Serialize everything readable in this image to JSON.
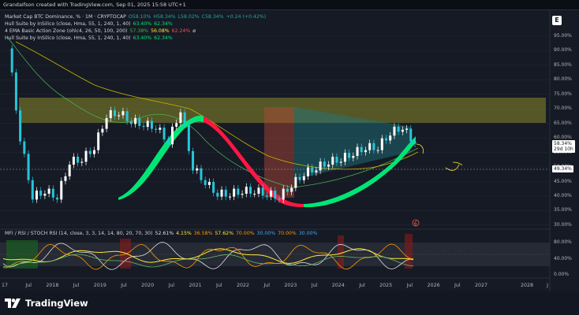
{
  "header": {
    "attribution": "GrandaIfson created with TradingView.com, Sep 01, 2025 15:58 UTC+1"
  },
  "legend": {
    "main": {
      "symbol": "Market Cap BTC Dominance, % · 1M · CRYPTOCAP",
      "open": "O58.10%",
      "high": "H58.34%",
      "low": "L58.02%",
      "close": "C58.34%",
      "change": "+0.24 (+0.42%)"
    },
    "ind1": {
      "name": "Hull Suite by InSilico (close, Hma, 55, 1, 240, 1, 40)",
      "v1": "63.40%",
      "v2": "62.34%"
    },
    "ind2": {
      "name": "4 EMA Basic Action Zone (ohlc4, 26, 50, 100, 200)",
      "v1": "57.38%",
      "v2": "56.08%",
      "v3": "62.24%",
      "v4": "ø"
    },
    "ind3": {
      "name": "Hull Suite by InSilico (close, Hma, 55, 1, 240, 1, 40)",
      "v1": "63.40%",
      "v2": "62.34%"
    },
    "osc": {
      "name": "MFI / RSI / STOCH RSI (14, close, 3, 3, 14, 14, 80, 20, 70, 30)",
      "v1": "52.61%",
      "v2": "4.15%",
      "v3": "36.58%",
      "v4": "57.62%",
      "v5": "70.00%",
      "v6": "30.00%",
      "v7": "70.00%",
      "v8": "30.00%"
    }
  },
  "price_axis": [
    "95.00%",
    "90.00%",
    "85.00%",
    "80.00%",
    "75.00%",
    "70.00%",
    "65.00%",
    "60.00%",
    "55.00%",
    "50.00%",
    "45.00%",
    "40.00%",
    "35.00%",
    "30.00%"
  ],
  "osc_axis": [
    "80.00%",
    "40.00%",
    "0.00%"
  ],
  "price_tags": {
    "current": "58.34%",
    "countdown": "29d 10h",
    "level": "49.34%"
  },
  "time_axis": [
    "17",
    "Jul",
    "2018",
    "Jul",
    "2019",
    "Jul",
    "2020",
    "Jul",
    "2021",
    "Jul",
    "2022",
    "Jul",
    "2023",
    "Jul",
    "2024",
    "Jul",
    "2025",
    "Jul",
    "2026",
    "Jul",
    "2027",
    "2028",
    "J"
  ],
  "ext_button_label": "E",
  "brand": "TradingView",
  "colors": {
    "background": "#161a25",
    "zone_yellow": "#8a8a2a",
    "hull_green": "#00e676",
    "hull_red": "#ff1744",
    "candle_up": "#ffffff",
    "candle_down": "#26c6da",
    "rsi_yellow": "#ffeb3b",
    "mfi_white": "#e0e0e0",
    "stoch_orange": "#ff9800"
  },
  "chart_data": {
    "type": "line",
    "title": "Market Cap BTC Dominance, % · 1M · CRYPTOCAP",
    "ylim": [
      30,
      97
    ],
    "x": [
      "2017-06",
      "2017-09",
      "2017-12",
      "2018-03",
      "2018-06",
      "2018-09",
      "2018-12",
      "2019-03",
      "2019-06",
      "2019-09",
      "2019-12",
      "2020-03",
      "2020-06",
      "2020-09",
      "2020-12",
      "2021-03",
      "2021-06",
      "2021-09",
      "2021-12",
      "2022-03",
      "2022-06",
      "2022-09",
      "2022-12",
      "2023-03",
      "2023-06",
      "2023-09",
      "2023-12",
      "2024-03",
      "2024-06",
      "2024-09",
      "2024-12",
      "2025-03",
      "2025-06",
      "2025-08"
    ],
    "series": [
      {
        "values": [
          92,
          60,
          40,
          42,
          40,
          52,
          53,
          57,
          68,
          69,
          66,
          65,
          64,
          59,
          70,
          50,
          45,
          41,
          41,
          42,
          42,
          41,
          40,
          44,
          48,
          50,
          52,
          53,
          55,
          57,
          57,
          62,
          64,
          58
        ]
      }
    ]
  }
}
